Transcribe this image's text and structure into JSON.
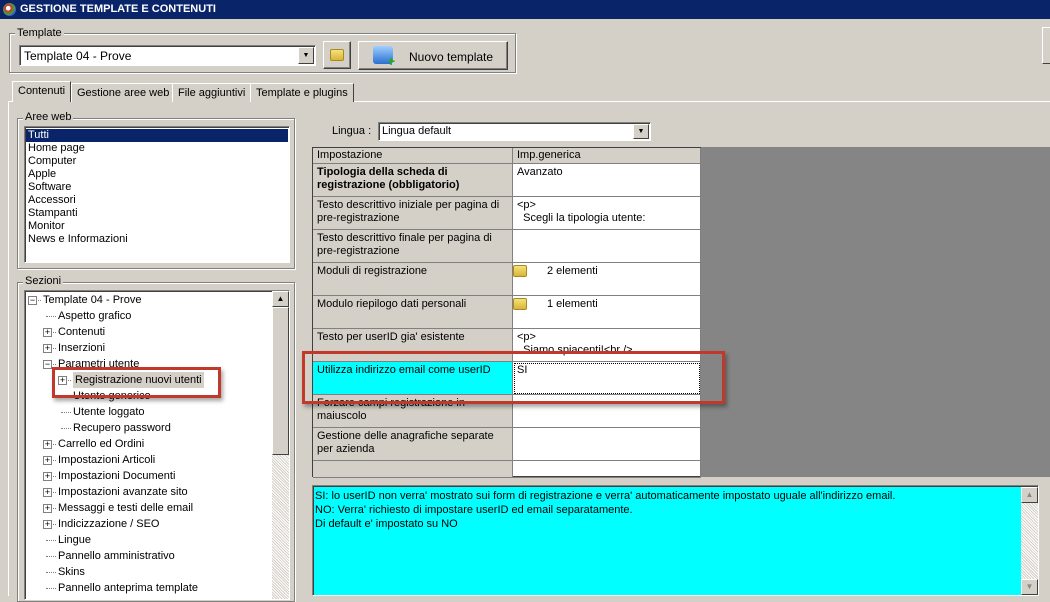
{
  "window": {
    "title": "GESTIONE TEMPLATE E CONTENUTI"
  },
  "template": {
    "group_label": "Template",
    "selected": "Template 04 - Prove",
    "new_button": "Nuovo template"
  },
  "tabs": [
    {
      "label": "Contenuti",
      "active": true
    },
    {
      "label": "Gestione aree web"
    },
    {
      "label": "File aggiuntivi"
    },
    {
      "label": "Template e plugins"
    }
  ],
  "aree_web": {
    "label": "Aree web",
    "items": [
      "Tutti",
      "Home page",
      "Computer",
      "Apple",
      "Software",
      "Accessori",
      "Stampanti",
      "Monitor",
      "News e Informazioni"
    ],
    "selected": "Tutti"
  },
  "sezioni": {
    "label": "Sezioni",
    "tree": [
      {
        "label": "Template 04 - Prove",
        "level": 0,
        "expander": "minus"
      },
      {
        "label": "Aspetto grafico",
        "level": 1,
        "expander": "none"
      },
      {
        "label": "Contenuti",
        "level": 1,
        "expander": "plus"
      },
      {
        "label": "Inserzioni",
        "level": 1,
        "expander": "plus"
      },
      {
        "label": "Parametri utente",
        "level": 1,
        "expander": "minus"
      },
      {
        "label": "Registrazione nuovi utenti",
        "level": 2,
        "expander": "plus",
        "selected": true
      },
      {
        "label": "Utente generico",
        "level": 2,
        "expander": "none"
      },
      {
        "label": "Utente loggato",
        "level": 2,
        "expander": "none"
      },
      {
        "label": "Recupero password",
        "level": 2,
        "expander": "none"
      },
      {
        "label": "Carrello ed Ordini",
        "level": 1,
        "expander": "plus"
      },
      {
        "label": "Impostazioni Articoli",
        "level": 1,
        "expander": "plus"
      },
      {
        "label": "Impostazioni Documenti",
        "level": 1,
        "expander": "plus"
      },
      {
        "label": "Impostazioni avanzate sito",
        "level": 1,
        "expander": "plus"
      },
      {
        "label": "Messaggi e testi delle email",
        "level": 1,
        "expander": "plus"
      },
      {
        "label": "Indicizzazione / SEO",
        "level": 1,
        "expander": "plus"
      },
      {
        "label": "Lingue",
        "level": 1,
        "expander": "none"
      },
      {
        "label": "Pannello amministrativo",
        "level": 1,
        "expander": "none"
      },
      {
        "label": "Skins",
        "level": 1,
        "expander": "none"
      },
      {
        "label": "Pannello anteprima template",
        "level": 1,
        "expander": "none"
      }
    ]
  },
  "lingua": {
    "label": "Lingua :",
    "selected": "Lingua default"
  },
  "grid": {
    "headers": [
      "Impostazione",
      "Imp.generica"
    ],
    "rows": [
      {
        "name": "Tipologia della scheda di registrazione (obbligatorio)",
        "value": "Avanzato",
        "bold": true
      },
      {
        "name": "Testo descrittivo iniziale per pagina di pre-registrazione",
        "value": "<p>\n  Scegli la tipologia utente:"
      },
      {
        "name": "Testo descrittivo finale per pagina di pre-registrazione",
        "value": ""
      },
      {
        "name": "Moduli di registrazione",
        "value": "2 elementi",
        "icon": "folder-icon"
      },
      {
        "name": "Modulo riepilogo dati personali",
        "value": "1 elementi",
        "icon": "folder-icon"
      },
      {
        "name": "Testo per userID gia' esistente",
        "value": "<p>\n  Siamo spiacenti!<br />"
      },
      {
        "name": "Utilizza indirizzo email come userID",
        "value": "SI",
        "selected": true
      },
      {
        "name": "Forzare campi registrazione in maiuscolo",
        "value": ""
      },
      {
        "name": "Gestione delle anagrafiche separate per azienda",
        "value": ""
      },
      {
        "name": "",
        "value": ""
      }
    ]
  },
  "description": [
    "SI: lo userID non verra' mostrato sui form di registrazione e verra' automaticamente impostato uguale all'indirizzo email.",
    "NO: Verra' richiesto di impostare userID ed email separatamente.",
    "Di default e' impostato su NO"
  ],
  "colors": {
    "titlebar": "#0a246a",
    "selected_cell": "#00ffff",
    "highlight": "#c0392b"
  }
}
